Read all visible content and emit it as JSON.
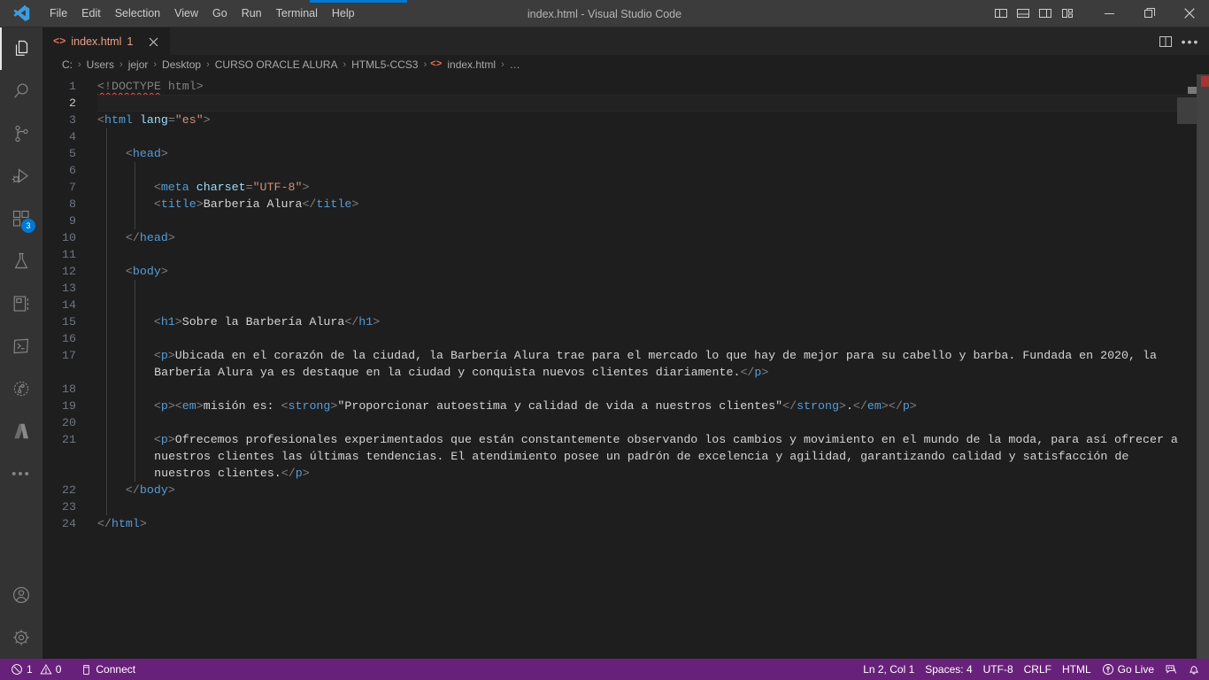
{
  "window": {
    "title": "index.html - Visual Studio Code",
    "logo_icon": "vscode-logo-icon",
    "controls": {
      "toggle_primary_sidebar": "toggle-primary-sidebar-icon",
      "toggle_panel": "toggle-panel-icon",
      "toggle_secondary_sidebar": "toggle-secondary-sidebar-icon",
      "customize_layout": "customize-layout-icon",
      "minimize": "minimize-icon",
      "maximize": "maximize-restore-icon",
      "close": "close-icon"
    }
  },
  "menubar": {
    "items": [
      {
        "label": "File"
      },
      {
        "label": "Edit"
      },
      {
        "label": "Selection"
      },
      {
        "label": "View"
      },
      {
        "label": "Go"
      },
      {
        "label": "Run"
      },
      {
        "label": "Terminal"
      },
      {
        "label": "Help"
      }
    ]
  },
  "activitybar": {
    "items": [
      {
        "name": "explorer",
        "icon": "files-explorer-icon",
        "active": true,
        "badge": ""
      },
      {
        "name": "search",
        "icon": "search-icon",
        "active": false,
        "badge": ""
      },
      {
        "name": "source-control",
        "icon": "source-control-branch-icon",
        "active": false,
        "badge": ""
      },
      {
        "name": "run-and-debug",
        "icon": "run-and-debug-icon",
        "active": false,
        "badge": ""
      },
      {
        "name": "extensions",
        "icon": "extensions-icon",
        "active": false,
        "badge": "3"
      },
      {
        "name": "testing",
        "icon": "testing-beaker-icon",
        "active": false,
        "badge": ""
      },
      {
        "name": "database",
        "icon": "database-book-icon",
        "active": false,
        "badge": ""
      },
      {
        "name": "terminal-panel",
        "icon": "terminal-square-icon",
        "active": false,
        "badge": ""
      },
      {
        "name": "timeline",
        "icon": "clock-branch-icon",
        "active": false,
        "badge": ""
      },
      {
        "name": "azure",
        "icon": "azure-icon",
        "active": false,
        "badge": ""
      },
      {
        "name": "additional-views",
        "icon": "ellipsis-icon",
        "active": false,
        "badge": ""
      }
    ],
    "bottom_items": [
      {
        "name": "accounts",
        "icon": "account-person-icon"
      },
      {
        "name": "manage-settings",
        "icon": "gear-icon"
      }
    ]
  },
  "tabs": {
    "items": [
      {
        "label": "index.html",
        "dirty_indicator": "1",
        "icon": "html-file-icon",
        "close_icon": "close-icon",
        "active": true
      }
    ],
    "actions": {
      "split_editor": "split-editor-icon",
      "more_actions": "more-actions-ellipsis-icon"
    }
  },
  "breadcrumb": {
    "separator": "›",
    "items": [
      {
        "label": "C:"
      },
      {
        "label": "Users"
      },
      {
        "label": "jejor"
      },
      {
        "label": "Desktop"
      },
      {
        "label": "CURSO ORACLE ALURA"
      },
      {
        "label": "HTML5-CCS3"
      },
      {
        "label": "index.html",
        "icon": "html-file-icon"
      },
      {
        "label": "…"
      }
    ]
  },
  "editor": {
    "current_line": 2,
    "first_line_number": 1,
    "last_line_number": 24,
    "lines": [
      {
        "n": 1,
        "indent_guides": 0,
        "segments": [
          {
            "t": "doctype-squiggle",
            "text": "<!DOCTYPE"
          },
          {
            "t": "txt",
            "text": " "
          },
          {
            "t": "doctype",
            "text": "html>"
          }
        ]
      },
      {
        "n": 2,
        "indent_guides": 0,
        "segments": []
      },
      {
        "n": 3,
        "indent_guides": 0,
        "segments": [
          {
            "t": "punct",
            "text": "<"
          },
          {
            "t": "tag",
            "text": "html"
          },
          {
            "t": "txt",
            "text": " "
          },
          {
            "t": "attr",
            "text": "lang"
          },
          {
            "t": "punct",
            "text": "="
          },
          {
            "t": "str",
            "text": "\"es\""
          },
          {
            "t": "punct",
            "text": ">"
          }
        ]
      },
      {
        "n": 4,
        "indent_guides": 1,
        "segments": []
      },
      {
        "n": 5,
        "indent_guides": 1,
        "segments": [
          {
            "t": "txt",
            "text": "    "
          },
          {
            "t": "punct",
            "text": "<"
          },
          {
            "t": "tag",
            "text": "head"
          },
          {
            "t": "punct",
            "text": ">"
          }
        ]
      },
      {
        "n": 6,
        "indent_guides": 2,
        "segments": []
      },
      {
        "n": 7,
        "indent_guides": 2,
        "segments": [
          {
            "t": "txt",
            "text": "        "
          },
          {
            "t": "punct",
            "text": "<"
          },
          {
            "t": "tag",
            "text": "meta"
          },
          {
            "t": "txt",
            "text": " "
          },
          {
            "t": "attr",
            "text": "charset"
          },
          {
            "t": "punct",
            "text": "="
          },
          {
            "t": "str",
            "text": "\"UTF-8\""
          },
          {
            "t": "punct",
            "text": ">"
          }
        ]
      },
      {
        "n": 8,
        "indent_guides": 2,
        "segments": [
          {
            "t": "txt",
            "text": "        "
          },
          {
            "t": "punct",
            "text": "<"
          },
          {
            "t": "tag",
            "text": "title"
          },
          {
            "t": "punct",
            "text": ">"
          },
          {
            "t": "txt",
            "text": "Barberia Alura"
          },
          {
            "t": "punct",
            "text": "</"
          },
          {
            "t": "tag",
            "text": "title"
          },
          {
            "t": "punct",
            "text": ">"
          }
        ]
      },
      {
        "n": 9,
        "indent_guides": 2,
        "segments": []
      },
      {
        "n": 10,
        "indent_guides": 1,
        "segments": [
          {
            "t": "txt",
            "text": "    "
          },
          {
            "t": "punct",
            "text": "</"
          },
          {
            "t": "tag",
            "text": "head"
          },
          {
            "t": "punct",
            "text": ">"
          }
        ]
      },
      {
        "n": 11,
        "indent_guides": 1,
        "segments": []
      },
      {
        "n": 12,
        "indent_guides": 1,
        "segments": [
          {
            "t": "txt",
            "text": "    "
          },
          {
            "t": "punct",
            "text": "<"
          },
          {
            "t": "tag",
            "text": "body"
          },
          {
            "t": "punct",
            "text": ">"
          }
        ]
      },
      {
        "n": 13,
        "indent_guides": 2,
        "segments": []
      },
      {
        "n": 14,
        "indent_guides": 2,
        "segments": []
      },
      {
        "n": 15,
        "indent_guides": 2,
        "segments": [
          {
            "t": "txt",
            "text": "        "
          },
          {
            "t": "punct",
            "text": "<"
          },
          {
            "t": "tag",
            "text": "h1"
          },
          {
            "t": "punct",
            "text": ">"
          },
          {
            "t": "txt",
            "text": "Sobre la Barbería Alura"
          },
          {
            "t": "punct",
            "text": "</"
          },
          {
            "t": "tag",
            "text": "h1"
          },
          {
            "t": "punct",
            "text": ">"
          }
        ]
      },
      {
        "n": 16,
        "indent_guides": 2,
        "segments": []
      },
      {
        "n": 17,
        "indent_guides": 2,
        "wrap": 2,
        "segments": [
          {
            "t": "txt",
            "text": "        "
          },
          {
            "t": "punct",
            "text": "<"
          },
          {
            "t": "tag",
            "text": "p"
          },
          {
            "t": "punct",
            "text": ">"
          },
          {
            "t": "txt",
            "text": "Ubicada en el corazón de la ciudad, la Barbería Alura trae para el mercado lo que hay de mejor para su cabello y barba. Fundada en 2020, la"
          },
          {
            "t": "br",
            "text": ""
          },
          {
            "t": "txt",
            "text": "Barbería Alura ya es destaque en la ciudad y conquista nuevos clientes diariamente."
          },
          {
            "t": "punct",
            "text": "</"
          },
          {
            "t": "tag",
            "text": "p"
          },
          {
            "t": "punct",
            "text": ">"
          }
        ]
      },
      {
        "n": 18,
        "indent_guides": 2,
        "segments": []
      },
      {
        "n": 19,
        "indent_guides": 2,
        "segments": [
          {
            "t": "txt",
            "text": "        "
          },
          {
            "t": "punct",
            "text": "<"
          },
          {
            "t": "tag",
            "text": "p"
          },
          {
            "t": "punct",
            "text": ">"
          },
          {
            "t": "punct",
            "text": "<"
          },
          {
            "t": "tag",
            "text": "em"
          },
          {
            "t": "punct",
            "text": ">"
          },
          {
            "t": "txt",
            "text": "misión es: "
          },
          {
            "t": "punct",
            "text": "<"
          },
          {
            "t": "tag",
            "text": "strong"
          },
          {
            "t": "punct",
            "text": ">"
          },
          {
            "t": "txt",
            "text": "\"Proporcionar autoestima y calidad de vida a nuestros clientes\""
          },
          {
            "t": "punct",
            "text": "</"
          },
          {
            "t": "tag",
            "text": "strong"
          },
          {
            "t": "punct",
            "text": ">"
          },
          {
            "t": "txt",
            "text": "."
          },
          {
            "t": "punct",
            "text": "</"
          },
          {
            "t": "tag",
            "text": "em"
          },
          {
            "t": "punct",
            "text": ">"
          },
          {
            "t": "punct",
            "text": "</"
          },
          {
            "t": "tag",
            "text": "p"
          },
          {
            "t": "punct",
            "text": ">"
          }
        ]
      },
      {
        "n": 20,
        "indent_guides": 2,
        "segments": []
      },
      {
        "n": 21,
        "indent_guides": 2,
        "wrap": 3,
        "segments": [
          {
            "t": "txt",
            "text": "        "
          },
          {
            "t": "punct",
            "text": "<"
          },
          {
            "t": "tag",
            "text": "p"
          },
          {
            "t": "punct",
            "text": ">"
          },
          {
            "t": "txt",
            "text": "Ofrecemos profesionales experimentados que están constantemente observando los cambios y movimiento en el mundo de la moda, para así ofrecer a"
          },
          {
            "t": "br",
            "text": ""
          },
          {
            "t": "txt",
            "text": "nuestros clientes las últimas tendencias. El atendimiento posee un padrón de excelencia y agilidad, garantizando calidad y satisfacción de"
          },
          {
            "t": "br",
            "text": ""
          },
          {
            "t": "txt",
            "text": "nuestros clientes."
          },
          {
            "t": "punct",
            "text": "</"
          },
          {
            "t": "tag",
            "text": "p"
          },
          {
            "t": "punct",
            "text": ">"
          }
        ]
      },
      {
        "n": 22,
        "indent_guides": 1,
        "segments": [
          {
            "t": "txt",
            "text": "    "
          },
          {
            "t": "punct",
            "text": "</"
          },
          {
            "t": "tag",
            "text": "body"
          },
          {
            "t": "punct",
            "text": ">"
          }
        ]
      },
      {
        "n": 23,
        "indent_guides": 1,
        "segments": []
      },
      {
        "n": 24,
        "indent_guides": 0,
        "segments": [
          {
            "t": "punct",
            "text": "</"
          },
          {
            "t": "tag",
            "text": "html"
          },
          {
            "t": "punct",
            "text": ">"
          }
        ]
      }
    ]
  },
  "statusbar": {
    "left": [
      {
        "name": "problems",
        "icon": "error-circle-icon",
        "errors": "1",
        "warn_icon": "warning-triangle-icon",
        "warnings": "0"
      },
      {
        "name": "remote-connect",
        "icon": "remote-window-icon",
        "label": "Connect"
      }
    ],
    "right": [
      {
        "name": "cursor-position",
        "label": "Ln 2, Col 1"
      },
      {
        "name": "indentation",
        "label": "Spaces: 4"
      },
      {
        "name": "encoding",
        "label": "UTF-8"
      },
      {
        "name": "eol",
        "label": "CRLF"
      },
      {
        "name": "language-mode",
        "label": "HTML"
      },
      {
        "name": "go-live",
        "label": "Go Live",
        "icon": "broadcast-icon"
      },
      {
        "name": "editor-feedback",
        "label": "",
        "icon": "feedback-smiley-icon"
      },
      {
        "name": "notifications",
        "label": "",
        "icon": "bell-icon"
      }
    ]
  },
  "colors": {
    "titlebar_bg": "#3c3c3c",
    "activitybar_bg": "#333333",
    "editor_bg": "#1e1e1e",
    "tabbar_bg": "#252526",
    "statusbar_bg": "#68217a",
    "accent_blue": "#0078d4",
    "tab_active_fg": "#e8a088",
    "badge_bg": "#0078d4",
    "error_red": "#f14c4c"
  }
}
